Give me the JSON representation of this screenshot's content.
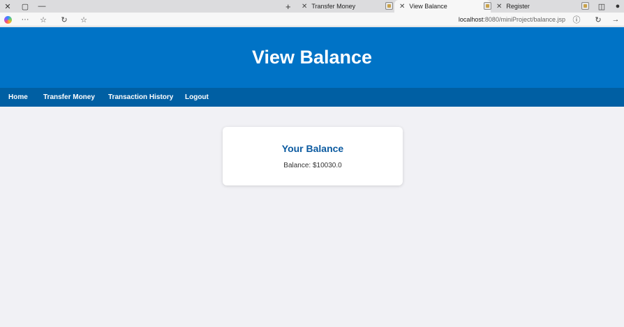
{
  "browser": {
    "tabs": [
      {
        "title": "Transfer Money",
        "active": false
      },
      {
        "title": "View Balance",
        "active": true
      },
      {
        "title": "Register",
        "active": false
      }
    ],
    "url_host": "localhost",
    "url_rest": ":8080/miniProject/balance.jsp"
  },
  "header": {
    "title": "View Balance"
  },
  "nav": {
    "items": [
      {
        "label": "Home"
      },
      {
        "label": "Transfer Money"
      },
      {
        "label": "Transaction History"
      },
      {
        "label": "Logout"
      }
    ]
  },
  "card": {
    "title": "Your Balance",
    "balance_label": "Balance: ",
    "balance_value": "$10030.0"
  },
  "colors": {
    "header_bg": "#0073c6",
    "nav_bg": "#005fa3",
    "page_bg": "#f1f1f5",
    "card_title": "#0b5aa0"
  }
}
